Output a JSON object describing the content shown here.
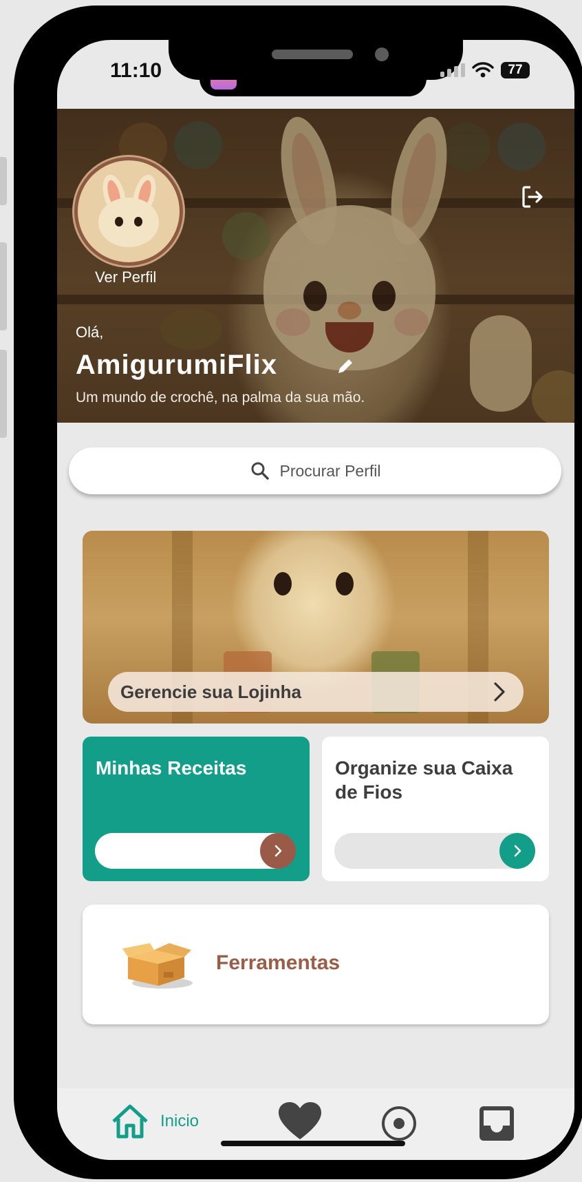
{
  "status_bar": {
    "time": "11:10",
    "battery": "77"
  },
  "header": {
    "profile_link": "Ver Perfil",
    "greeting": "Olá,",
    "app_name": "AmigurumiFlix",
    "tagline": "Um mundo de crochê, na palma da sua mão."
  },
  "search": {
    "placeholder": "Procurar Perfil"
  },
  "shop_banner": {
    "label": "Gerencie sua Lojinha"
  },
  "cards": [
    {
      "title": "Minhas Receitas"
    },
    {
      "title": "Organize sua Caixa de Fios"
    }
  ],
  "tools": {
    "label": "Ferramentas"
  },
  "tabbar": {
    "home_label": "Inicio"
  },
  "colors": {
    "accent": "#139e89",
    "brown": "#9a5a48"
  },
  "icons": [
    "logout-icon",
    "edit-icon",
    "search-icon",
    "chevron-right-icon",
    "box-icon",
    "home-icon",
    "heart-icon",
    "radio-icon",
    "inbox-icon"
  ]
}
